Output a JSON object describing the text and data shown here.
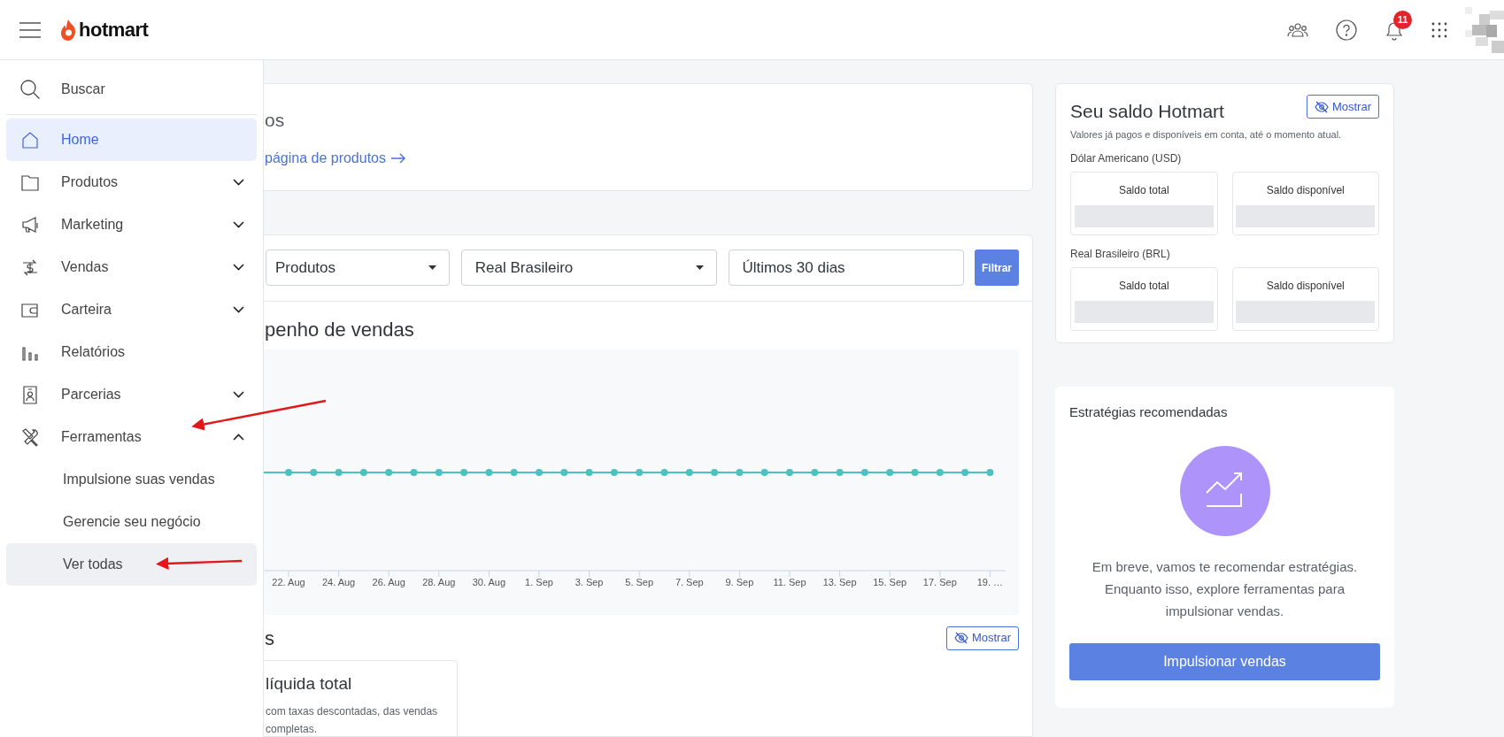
{
  "header": {
    "logo": "hotmart",
    "notifications_badge": "11"
  },
  "sidebar": {
    "search": "Buscar",
    "items": [
      {
        "label": "Home",
        "kind": "link",
        "selected": true
      },
      {
        "label": "Produtos",
        "kind": "group",
        "selected": false,
        "expanded": false
      },
      {
        "label": "Marketing",
        "kind": "group",
        "selected": false,
        "expanded": false
      },
      {
        "label": "Vendas",
        "kind": "group",
        "selected": false,
        "expanded": false
      },
      {
        "label": "Carteira",
        "kind": "group",
        "selected": false,
        "expanded": false
      },
      {
        "label": "Relatórios",
        "kind": "link",
        "selected": false
      },
      {
        "label": "Parcerias",
        "kind": "group",
        "selected": false,
        "expanded": false
      },
      {
        "label": "Ferramentas",
        "kind": "group",
        "selected": false,
        "expanded": true,
        "children": [
          {
            "label": "Impulsione suas vendas",
            "hovered": false
          },
          {
            "label": "Gerencie seu negócio",
            "hovered": false
          },
          {
            "label": "Ver todas",
            "hovered": true
          }
        ]
      }
    ]
  },
  "products_card": {
    "title": "os",
    "link": "página de produtos"
  },
  "filters": {
    "product_select": "Produtos",
    "currency_select": "Real Brasileiro",
    "period_field": "Últimos 30 dias",
    "button": "Filtrar"
  },
  "sales_chart": {
    "title": "penho de vendas",
    "x_labels": [
      "22. Aug",
      "24. Aug",
      "26. Aug",
      "28. Aug",
      "30. Aug",
      "1. Sep",
      "3. Sep",
      "5. Sep",
      "7. Sep",
      "9. Sep",
      "11. Sep",
      "13. Sep",
      "15. Sep",
      "17. Sep",
      "19. …"
    ]
  },
  "revenue": {
    "title": "s",
    "button": "Mostrar",
    "card_title": "líquida total",
    "card_description": "com taxas descontadas, das vendas completas."
  },
  "balance": {
    "title": "Seu saldo Hotmart",
    "button": "Mostrar",
    "subtitle": "Valores já pagos e disponíveis em conta, até o momento atual.",
    "currencies": [
      {
        "label": "Dólar Americano (USD)",
        "boxes": [
          "Saldo total",
          "Saldo disponível"
        ]
      },
      {
        "label": "Real Brasileiro (BRL)",
        "boxes": [
          "Saldo total",
          "Saldo disponível"
        ]
      }
    ]
  },
  "strategies": {
    "title": "Estratégias recomendadas",
    "message_lines": [
      "Em breve, vamos te recomendar estratégias.",
      "Enquanto isso, explore ferramentas para",
      "impulsionar vendas."
    ],
    "button": "Impulsionar vendas"
  }
}
